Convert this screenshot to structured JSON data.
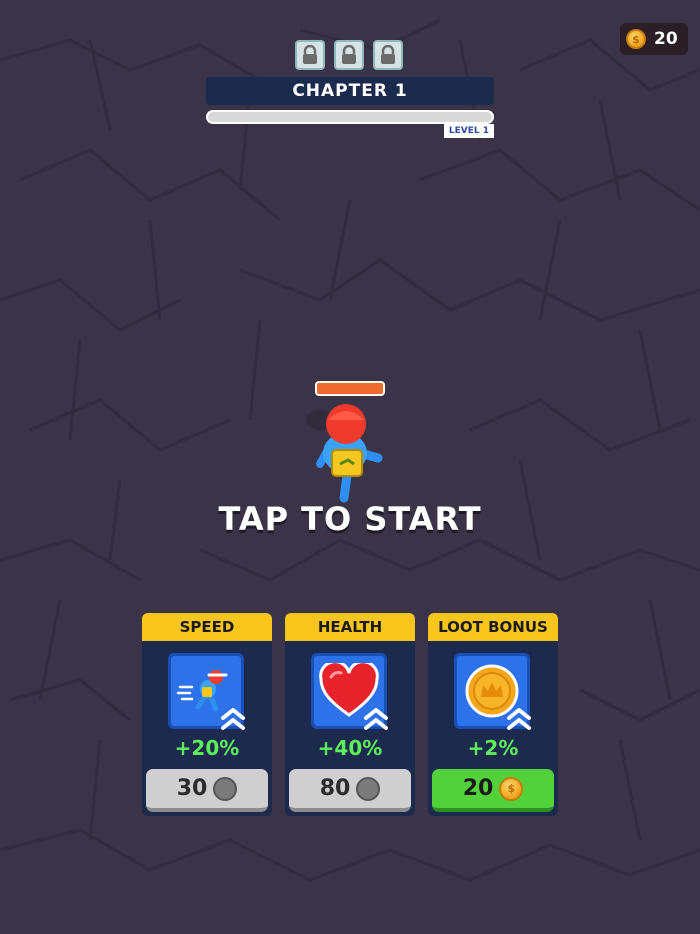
{
  "currency": {
    "amount": "20",
    "icon": "coin-icon"
  },
  "chapter": {
    "title": "CHAPTER 1",
    "level": "LEVEL 1",
    "progress": 0,
    "locks": [
      "lock-icon",
      "lock-icon",
      "lock-icon"
    ]
  },
  "player": {
    "health_fraction": 1.0
  },
  "prompt": "TAP TO START",
  "upgrades": [
    {
      "name": "SPEED",
      "bonus": "+20%",
      "cost": "30",
      "affordable": false,
      "icon": "runner-icon"
    },
    {
      "name": "HEALTH",
      "bonus": "+40%",
      "cost": "80",
      "affordable": false,
      "icon": "heart-icon"
    },
    {
      "name": "LOOT BONUS",
      "bonus": "+2%",
      "cost": "20",
      "affordable": true,
      "icon": "crown-coin-icon"
    }
  ],
  "colors": {
    "background": "#3b3347",
    "card_header": "#f8c51d",
    "card_body": "#1c2a4e",
    "bonus_text": "#5ef05b",
    "buy_enabled": "#52d13a",
    "buy_disabled": "#cfcfcf"
  }
}
